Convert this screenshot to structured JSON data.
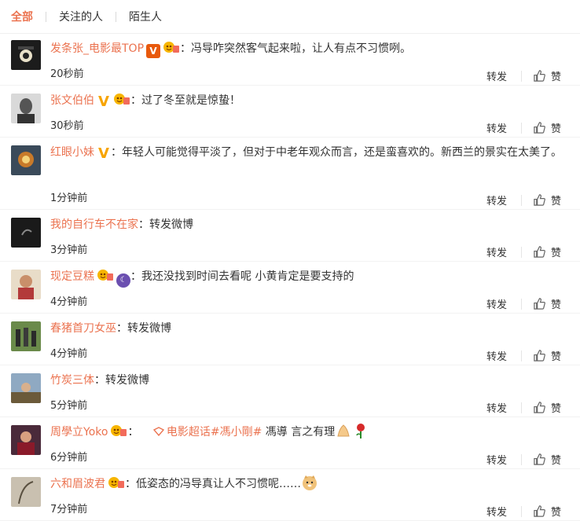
{
  "tabs": [
    "全部",
    "关注的人",
    "陌生人"
  ],
  "actions": {
    "repost": "转发",
    "like": "赞"
  },
  "colors": {
    "accent": "#eb7350",
    "vip_badge": "#e8590c",
    "v_badge": "#f7a400"
  },
  "comments": [
    {
      "user": "发条张_电影最TOP",
      "badges": [
        "vip-icon",
        "fan-badge-icon"
      ],
      "text": "：冯导咋突然客气起来啦，让人有点不习惯咧。",
      "time": "20秒前"
    },
    {
      "user": "张文伯伯",
      "badges": [
        "v-verified-icon",
        "fan-badge-icon"
      ],
      "text": "：过了冬至就是惊蛰！",
      "time": "30秒前"
    },
    {
      "user": "红眼小妹",
      "badges": [
        "v-verified-icon"
      ],
      "text": "：年轻人可能觉得平淡了，但对于中老年观众而言，还是蛮喜欢的。新西兰的景实在太美了。",
      "time": "1分钟前"
    },
    {
      "user": "我的自行车不在家",
      "badges": [],
      "text": "：转发微博",
      "time": "3分钟前"
    },
    {
      "user": "现定豆糕",
      "badges": [
        "fan-badge-icon",
        "moon-badge-icon"
      ],
      "text": "：我还没找到时间去看呢 小黄肯定是要支持的",
      "time": "4分钟前"
    },
    {
      "user": "春猪首刀女巫",
      "badges": [],
      "text": "：转发微博",
      "time": "4分钟前"
    },
    {
      "user": "竹炭三体",
      "badges": [],
      "text": "：转发微博",
      "time": "5分钟前"
    },
    {
      "user": "周學立Yoko",
      "badges": [
        "fan-badge-icon"
      ],
      "text_pre": "：",
      "supertopic": "电影超话",
      "hashtag": "#馮小剛#",
      "text_post": " 馮導 言之有理",
      "emojis": [
        "pray-hands-emoji",
        "rose-emoji"
      ],
      "time": "6分钟前"
    },
    {
      "user": "六和眉波君",
      "badges": [
        "fan-badge-icon"
      ],
      "text": "：低姿态的冯导真让人不习惯呢……",
      "emojis": [
        "doge-emoji"
      ],
      "time": "7分钟前"
    }
  ]
}
